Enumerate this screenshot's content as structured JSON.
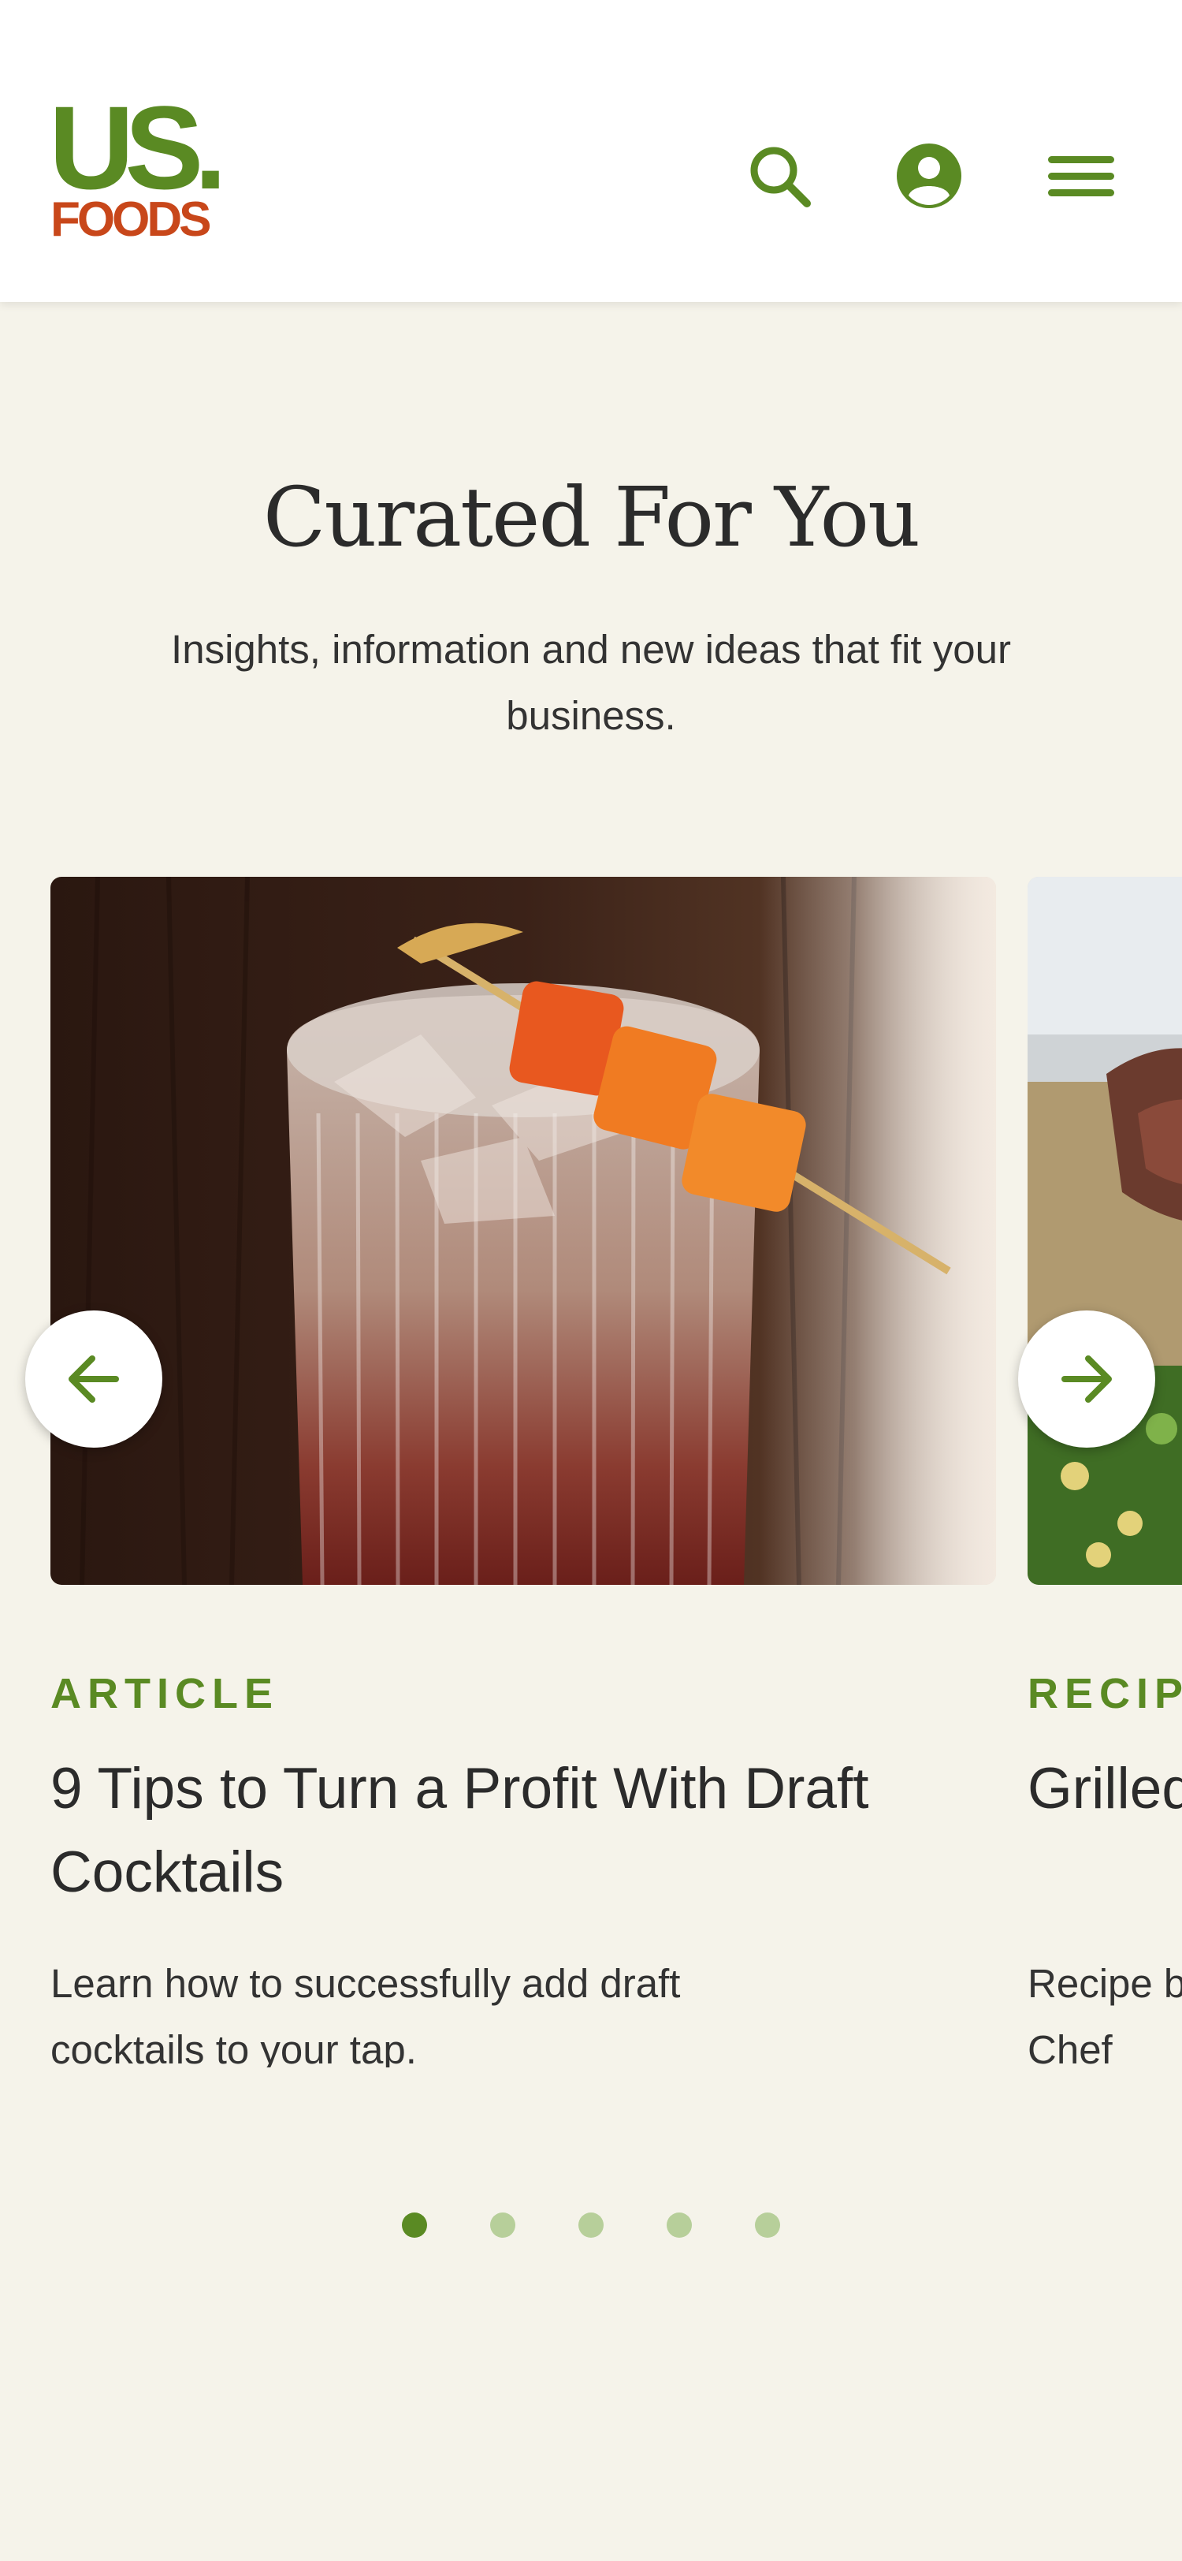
{
  "header": {
    "brand_us": "US.",
    "brand_foods": "FOODS",
    "icons": [
      "search-icon",
      "account-icon",
      "menu-icon"
    ]
  },
  "section": {
    "title": "Curated For You",
    "subtitle": "Insights, information and new ideas that fit your business."
  },
  "carousel": {
    "prev_icon": "arrow-left-icon",
    "next_icon": "arrow-right-icon",
    "cards": [
      {
        "category": "ARTICLE",
        "title": "9 Tips to Turn a Profit With Draft Cocktails",
        "description": "Learn how to successfully add draft cocktails to your tap."
      },
      {
        "category": "RECIPE",
        "title": "Grilled Chimi",
        "description": "Recipe b Chef"
      }
    ],
    "page_count": 5,
    "active_page": 1
  },
  "colors": {
    "brand_green": "#5a8a23",
    "brand_orange": "#c8471a",
    "page_bg": "#f5f3ea",
    "dot_inactive": "#b7cf9a"
  }
}
